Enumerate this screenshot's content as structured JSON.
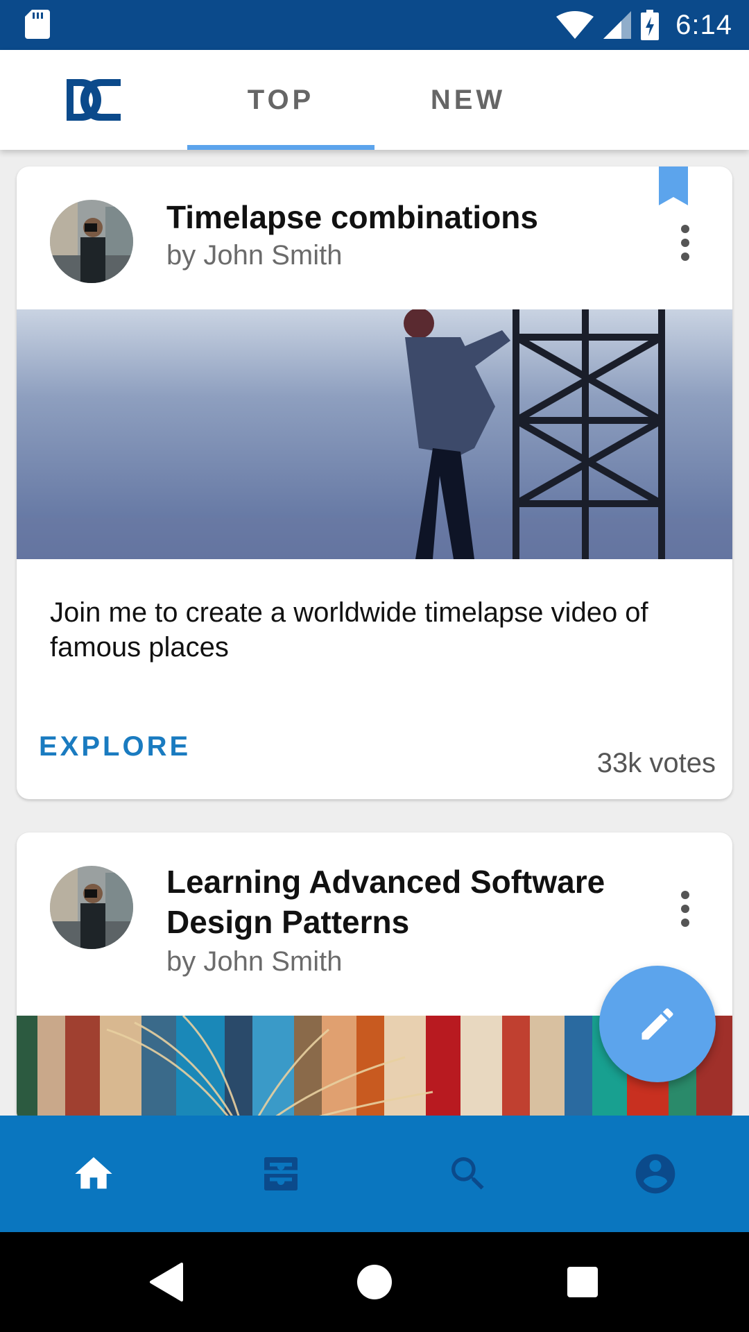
{
  "status_bar": {
    "time": "6:14"
  },
  "tabs": [
    {
      "label": "TOP",
      "selected": true
    },
    {
      "label": "NEW",
      "selected": false
    }
  ],
  "colors": {
    "status_bar": "#0b4a8b",
    "accent": "#5ca4ec",
    "bottom_nav": "#0a76bf",
    "link": "#1a7bc0"
  },
  "posts": [
    {
      "title": "Timelapse combinations",
      "author": "by John Smith",
      "description": "Join me to create a worldwide timelapse video of famous places",
      "action_label": "EXPLORE",
      "votes": "33k votes",
      "bookmarked": true
    },
    {
      "title": "Learning Advanced Software Design Patterns",
      "author": "by John Smith"
    }
  ],
  "fab": {
    "icon": "pencil-icon"
  },
  "bottom_nav": [
    {
      "icon": "home-icon",
      "selected": true
    },
    {
      "icon": "inbox-icon",
      "selected": false
    },
    {
      "icon": "search-icon",
      "selected": false
    },
    {
      "icon": "account-icon",
      "selected": false
    }
  ],
  "system_nav": [
    "back-icon",
    "home-circle-icon",
    "recents-icon"
  ]
}
